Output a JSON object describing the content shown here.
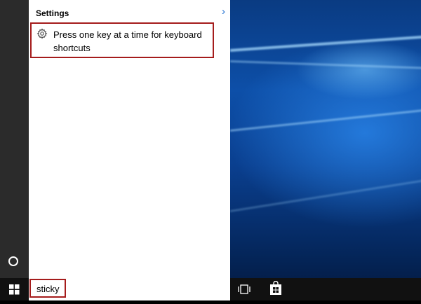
{
  "search_panel": {
    "section_title": "Settings",
    "result": {
      "label": "Press one key at a time for keyboard shortcuts",
      "icon": "gear-icon"
    }
  },
  "taskbar": {
    "search_query": "sticky",
    "icons": [
      "windows-start-icon",
      "task-view-icon",
      "store-icon",
      "cortana-icon"
    ]
  },
  "colors": {
    "highlight_border": "#a51c1c",
    "accent": "#1f6fd1",
    "taskbar": "#111111"
  }
}
